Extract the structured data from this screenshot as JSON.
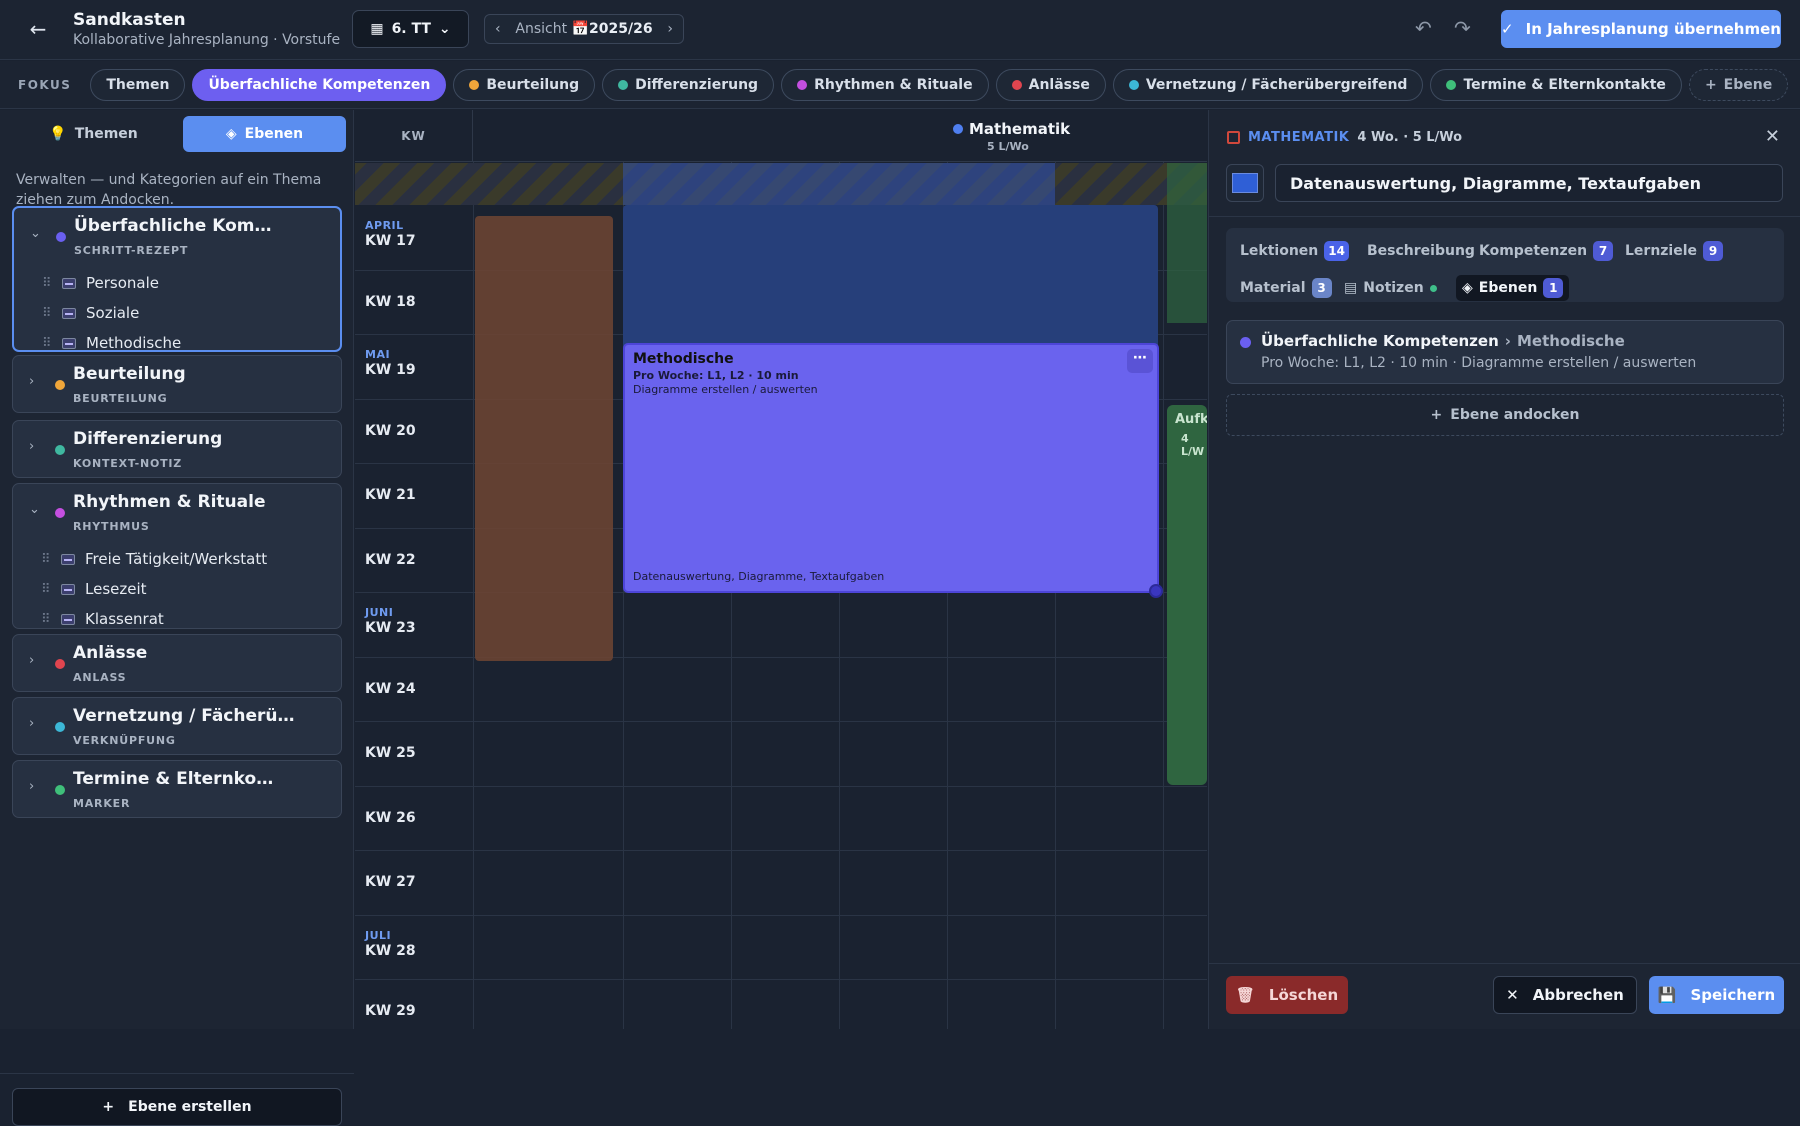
{
  "header": {
    "title": "Sandkasten",
    "subtitle": "Kollaborative Jahresplanung · Vorstufe",
    "class_selector": "6. TT",
    "view_label": "Ansicht",
    "view_year": "2025/26",
    "adopt_button": "In Jahresplanung übernehmen"
  },
  "focusbar": {
    "label": "FOKUS",
    "chips": [
      {
        "label": "Themen",
        "color": null,
        "active": false
      },
      {
        "label": "Überfachliche Kompetenzen",
        "color": null,
        "active": true
      },
      {
        "label": "Beurteilung",
        "color": "#f0a63a",
        "active": false
      },
      {
        "label": "Differenzierung",
        "color": "#3fb8a0",
        "active": false
      },
      {
        "label": "Rhythmen & Rituale",
        "color": "#c44fe0",
        "active": false
      },
      {
        "label": "Anlässe",
        "color": "#e0454f",
        "active": false
      },
      {
        "label": "Vernetzung / Fächerübergreifend",
        "color": "#3cb7d6",
        "active": false
      },
      {
        "label": "Termine & Elternkontakte",
        "color": "#3fbf7a",
        "active": false
      }
    ],
    "add_label": "Ebene"
  },
  "sidebar": {
    "tab_themes": "Themen",
    "tab_layers": "Ebenen",
    "hint": "Verwalten — und Kategorien auf ein Thema ziehen zum Andocken.",
    "cards": [
      {
        "title": "Überfachliche Kom…",
        "sub": "SCHRITT-REZEPT",
        "color": "#6a5ff0",
        "items": [
          "Personale",
          "Soziale",
          "Methodische"
        ]
      },
      {
        "title": "Beurteilung",
        "sub": "BEURTEILUNG",
        "color": "#f0a63a"
      },
      {
        "title": "Differenzierung",
        "sub": "KONTEXT-NOTIZ",
        "color": "#3fb8a0"
      },
      {
        "title": "Rhythmen & Rituale",
        "sub": "RHYTHMUS",
        "color": "#c44fe0",
        "items": [
          "Freie Tätigkeit/Werkstatt",
          "Lesezeit",
          "Klassenrat"
        ]
      },
      {
        "title": "Anlässe",
        "sub": "ANLASS",
        "color": "#e0454f"
      },
      {
        "title": "Vernetzung / Fächerü…",
        "sub": "VERKNÜPFUNG",
        "color": "#3cb7d6"
      },
      {
        "title": "Termine & Elternko…",
        "sub": "MARKER",
        "color": "#3fbf7a"
      }
    ],
    "create_button": "Ebene erstellen"
  },
  "grid": {
    "kw_header": "KW",
    "subject": "Mathematik",
    "subject_meta": "5 L/Wo",
    "weeks": [
      {
        "month": "APRIL",
        "kw": "KW 17"
      },
      {
        "month": "",
        "kw": "KW 18"
      },
      {
        "month": "MAI",
        "kw": "KW 19"
      },
      {
        "month": "",
        "kw": "KW 20"
      },
      {
        "month": "",
        "kw": "KW 21"
      },
      {
        "month": "",
        "kw": "KW 22"
      },
      {
        "month": "JUNI",
        "kw": "KW 23"
      },
      {
        "month": "",
        "kw": "KW 24"
      },
      {
        "month": "",
        "kw": "KW 25"
      },
      {
        "month": "",
        "kw": "KW 26"
      },
      {
        "month": "",
        "kw": "KW 27"
      },
      {
        "month": "JULI",
        "kw": "KW 28"
      },
      {
        "month": "",
        "kw": "KW 29"
      }
    ],
    "layer_block": {
      "title": "Methodische",
      "line1": "Pro Woche: L1, L2 · 10 min",
      "line2": "Diagramme erstellen / auswerten",
      "footer": "Datenauswertung, Diagramme, Textaufgaben"
    },
    "side_block_title": "Aufk",
    "side_block_meta": "4 L/W"
  },
  "detail": {
    "subject": "MATHEMATIK",
    "meta": "4 Wo. · 5 L/Wo",
    "color": "#2f5fd6",
    "name_value": "Datenauswertung, Diagramme, Textaufgaben",
    "tabs": {
      "lessons": "Lektionen",
      "lessons_count": "14",
      "description": "Beschreibung",
      "competencies": "Kompetenzen",
      "competencies_count": "7",
      "goals": "Lernziele",
      "goals_count": "9",
      "material": "Material",
      "material_count": "3",
      "notes": "Notizen",
      "layers": "Ebenen",
      "layers_count": "1"
    },
    "layer": {
      "parent": "Überfachliche Kompetenzen",
      "child": "Methodische",
      "desc": "Pro Woche: L1, L2 · 10 min · Diagramme erstellen / auswerten"
    },
    "dock_button": "Ebene andocken",
    "delete_button": "Löschen",
    "cancel_button": "Abbrechen",
    "save_button": "Speichern"
  }
}
